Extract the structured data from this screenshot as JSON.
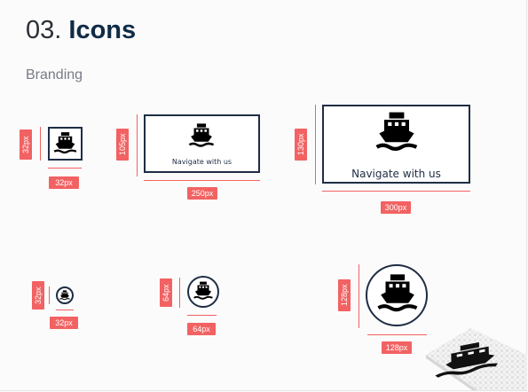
{
  "header": {
    "number": "03.",
    "title": "Icons"
  },
  "section": {
    "label": "Branding"
  },
  "brand": {
    "tagline": "Navigate with us",
    "stroke_color": "#1f2d44",
    "accent_color": "#f26262"
  },
  "rectangles": [
    {
      "width_label": "32px",
      "height_label": "32px"
    },
    {
      "width_label": "250px",
      "height_label": "105px"
    },
    {
      "width_label": "300px",
      "height_label": "130px"
    }
  ],
  "circles": [
    {
      "width_label": "32px",
      "height_label": "32px"
    },
    {
      "width_label": "64px",
      "height_label": "64px"
    },
    {
      "width_label": "128px",
      "height_label": "128px"
    }
  ],
  "icons": {
    "logo": "ship-icon",
    "decoration": "ship-3d-icon"
  }
}
